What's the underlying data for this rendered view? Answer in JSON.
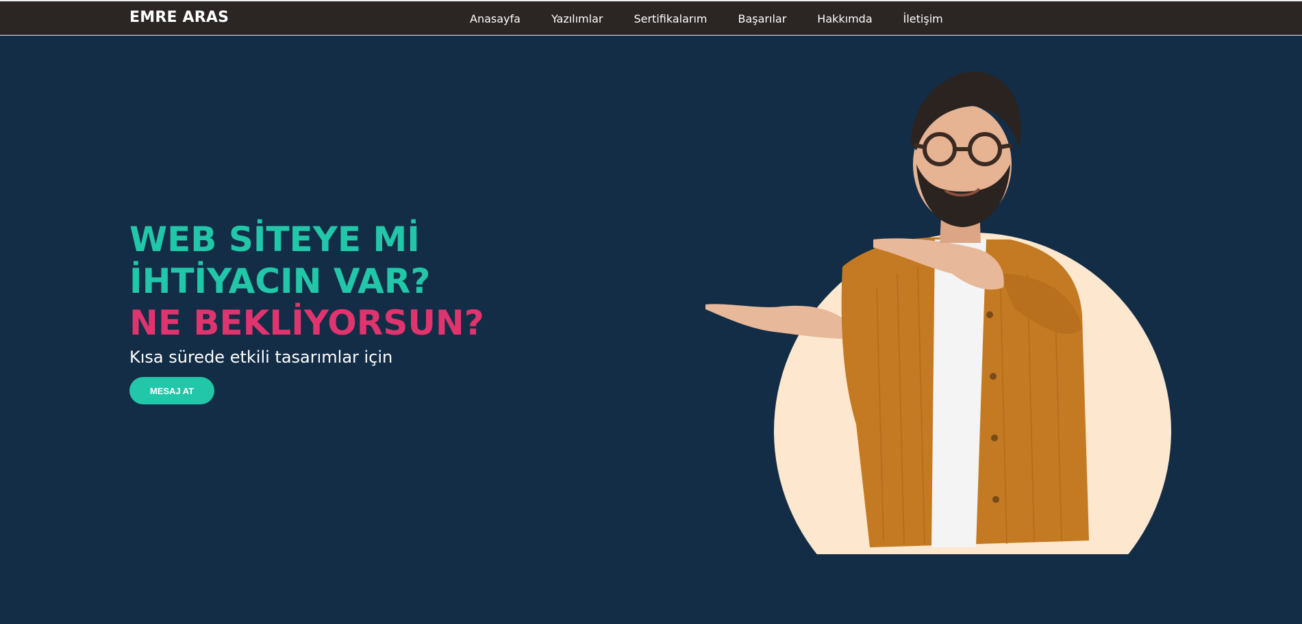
{
  "brand": {
    "name": "EMRE ARAS"
  },
  "nav": {
    "items": [
      {
        "label": "Anasayfa"
      },
      {
        "label": "Yazılımlar"
      },
      {
        "label": "Sertifikalarım"
      },
      {
        "label": "Başarılar"
      },
      {
        "label": "Hakkımda"
      },
      {
        "label": "İletişim"
      }
    ]
  },
  "hero": {
    "headline_part1": "WEB SİTEYE Mİ İHTİYACIN VAR?",
    "headline_part2": "NE BEKLİYORSUN?",
    "subtitle": "Kısa sürede etkili tasarımlar için",
    "cta_label": "MESAJ AT",
    "image_icon": "man-pointing-illustration"
  },
  "colors": {
    "nav_bg": "#2b2524",
    "page_bg": "#132d46",
    "accent_teal": "#22c7a9",
    "accent_pink": "#e0346f",
    "circle_bg": "#fde8cf",
    "jacket": "#c47a22"
  }
}
